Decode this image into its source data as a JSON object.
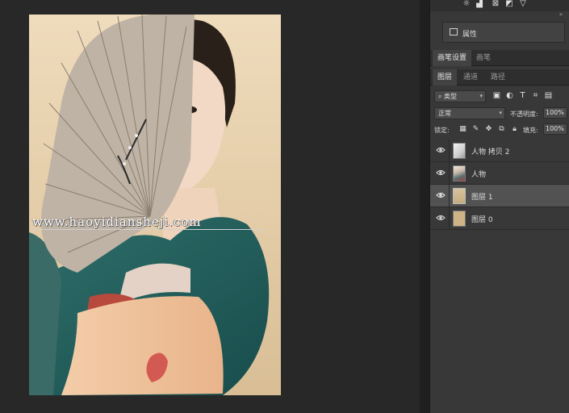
{
  "canvas": {
    "watermark": "www.haoyidiansheji.com"
  },
  "panel": {
    "properties_label": "属性",
    "tabs_top": [
      {
        "label": "画笔设置",
        "active": true
      },
      {
        "label": "画笔",
        "active": false
      }
    ],
    "tabs_layers": [
      {
        "label": "图层",
        "active": true
      },
      {
        "label": "通道",
        "active": false
      },
      {
        "label": "路径",
        "active": false
      }
    ],
    "filter": {
      "kind": "类型",
      "icon": "search-icon"
    },
    "blend_mode": "正常",
    "opacity_label": "不透明度:",
    "opacity_value": "100%",
    "lock_label": "锁定:",
    "fill_label": "填充:",
    "fill_value": "100%",
    "layers": [
      {
        "name": "人物 拷贝 2",
        "selected": false,
        "thumb": "person-copy"
      },
      {
        "name": "人物",
        "selected": false,
        "thumb": "person"
      },
      {
        "name": "图层 1",
        "selected": true,
        "thumb": "tan"
      },
      {
        "name": "图层 0",
        "selected": false,
        "thumb": "tan-solid"
      }
    ]
  },
  "colors": {
    "selected_layer_bg": "#525252",
    "panel_bg": "#383838",
    "canvas_bg": "#282828"
  }
}
